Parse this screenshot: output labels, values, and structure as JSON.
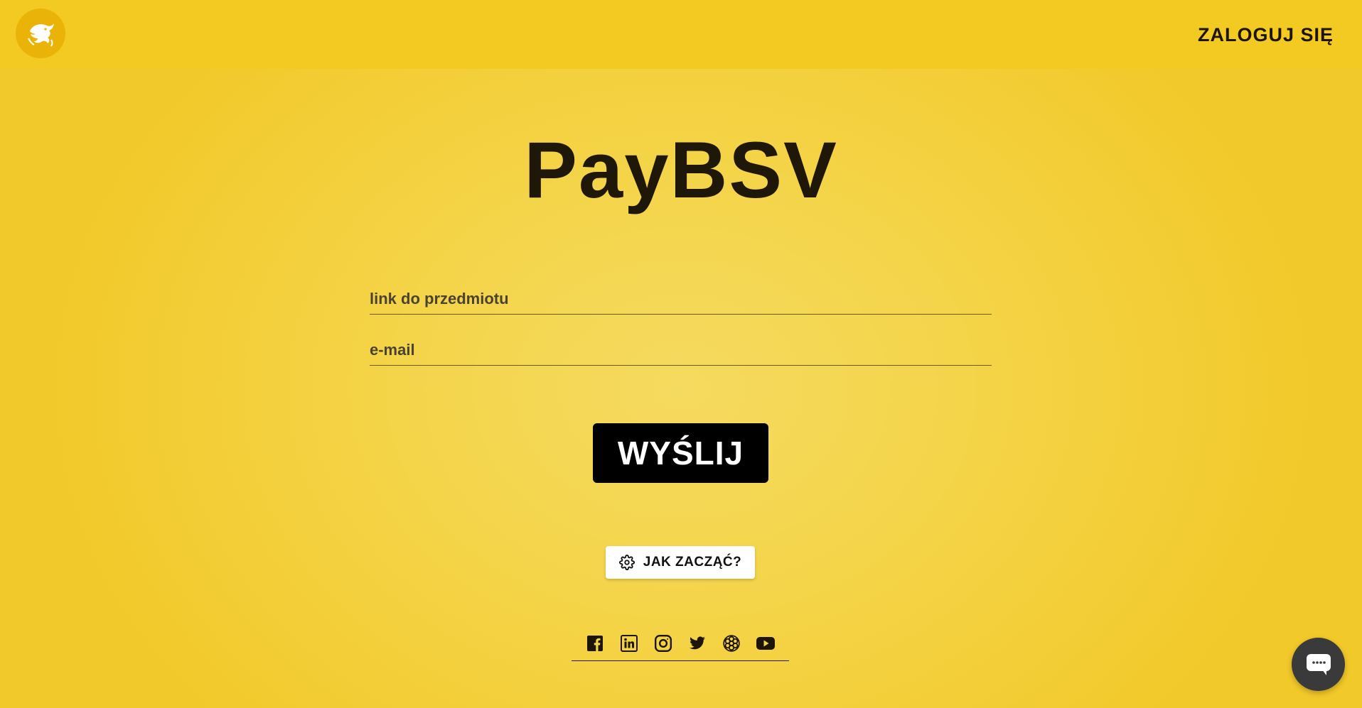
{
  "header": {
    "logo_icon": "bsv-dragon-logo-icon",
    "login_label": "ZALOGUJ SIĘ"
  },
  "main": {
    "title": "PayBSV",
    "form": {
      "link_placeholder": "link do przedmiotu",
      "link_value": "",
      "email_placeholder": "e-mail",
      "email_value": "",
      "submit_label": "WYŚLIJ"
    },
    "help_button": {
      "icon": "gear-icon",
      "label": "JAK ZACZĄĆ?"
    }
  },
  "footer": {
    "socials": [
      "facebook-icon",
      "linkedin-icon",
      "instagram-icon",
      "twitter-icon",
      "network-icon",
      "youtube-icon"
    ]
  },
  "chat": {
    "icon": "chat-icon"
  },
  "colors": {
    "background": "#f4d448",
    "topbar": "#f3ca22",
    "text": "#1c1508",
    "button": "#000000",
    "chat": "#3a3a3a"
  }
}
